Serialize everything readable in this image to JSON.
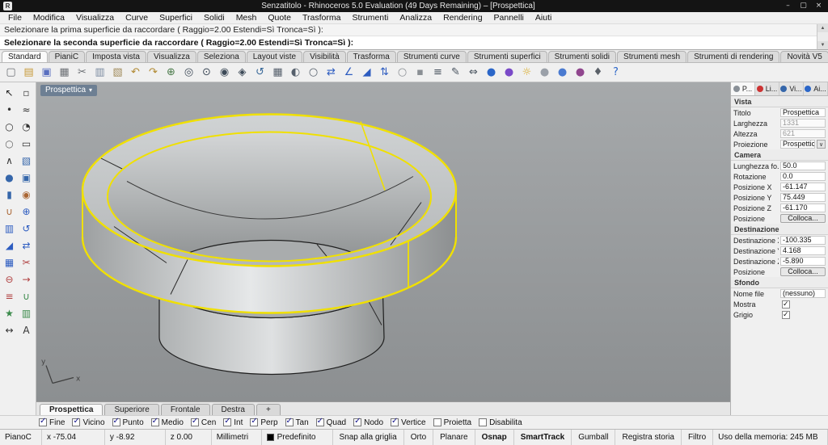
{
  "title_bar": {
    "title": "Senzatitolo - Rhinoceros 5.0 Evaluation (49 Days Remaining) – [Prospettica]",
    "window_controls": [
      {
        "name": "minimize-button",
        "glyph": "–"
      },
      {
        "name": "maximize-button",
        "glyph": "▢"
      },
      {
        "name": "close-button",
        "glyph": "×"
      }
    ]
  },
  "menu_bar": {
    "items": [
      "File",
      "Modifica",
      "Visualizza",
      "Curve",
      "Superfici",
      "Solidi",
      "Mesh",
      "Quote",
      "Trasforma",
      "Strumenti",
      "Analizza",
      "Rendering",
      "Pannelli",
      "Aiuti"
    ]
  },
  "command": {
    "line1": "Selezionare la prima superficie da raccordare ( Raggio=2.00  Estendi=Sì  Tronca=Sì ):",
    "line2": "Selezionare la seconda superficie da raccordare ( Raggio=2.00  Estendi=Sì  Tronca=Sì ):"
  },
  "ribbon": {
    "tabs": [
      {
        "label": "Standard",
        "active": true
      },
      {
        "label": "PianiC"
      },
      {
        "label": "Imposta vista"
      },
      {
        "label": "Visualizza"
      },
      {
        "label": "Seleziona"
      },
      {
        "label": "Layout viste"
      },
      {
        "label": "Visibilità"
      },
      {
        "label": "Trasforma"
      },
      {
        "label": "Strumenti curve"
      },
      {
        "label": "Strumenti superfici"
      },
      {
        "label": "Strumenti solidi"
      },
      {
        "label": "Strumenti mesh"
      },
      {
        "label": "Strumenti di rendering"
      },
      {
        "label": "Novità V5"
      }
    ]
  },
  "toolbar": {
    "icons": [
      {
        "name": "new-file-icon",
        "glyph": "▢",
        "color": "#6b6f74"
      },
      {
        "name": "open-file-icon",
        "glyph": "▤",
        "color": "#c79a3a"
      },
      {
        "name": "save-icon",
        "glyph": "▣",
        "color": "#5a6fc0"
      },
      {
        "name": "print-icon",
        "glyph": "▦",
        "color": "#6b6f74"
      },
      {
        "name": "cut-icon",
        "glyph": "✂",
        "color": "#6b6f74"
      },
      {
        "name": "copy-icon",
        "glyph": "▥",
        "color": "#7a8aa0"
      },
      {
        "name": "paste-icon",
        "glyph": "▧",
        "color": "#a08a5a"
      },
      {
        "name": "undo-icon",
        "glyph": "↶",
        "color": "#b08830"
      },
      {
        "name": "redo-icon",
        "glyph": "↷",
        "color": "#b08830"
      },
      {
        "name": "pan-icon",
        "glyph": "⊕",
        "color": "#4a7a4a"
      },
      {
        "name": "zoom-dynamic-icon",
        "glyph": "◎",
        "color": "#3d4a58"
      },
      {
        "name": "zoom-window-icon",
        "glyph": "⊙",
        "color": "#3d4a58"
      },
      {
        "name": "zoom-extents-icon",
        "glyph": "◉",
        "color": "#3d4a58"
      },
      {
        "name": "zoom-selected-icon",
        "glyph": "◈",
        "color": "#3d4a58"
      },
      {
        "name": "undo-view-icon",
        "glyph": "↺",
        "color": "#3a6a9a"
      },
      {
        "name": "four-viewports-icon",
        "glyph": "▦",
        "color": "#56606c"
      },
      {
        "name": "shaded-view-icon",
        "glyph": "◐",
        "color": "#56606c"
      },
      {
        "name": "wireframe-view-icon",
        "glyph": "○",
        "color": "#56606c"
      },
      {
        "name": "move-icon",
        "glyph": "⇄",
        "color": "#2d5cc0"
      },
      {
        "name": "rotate-icon",
        "glyph": "∠",
        "color": "#2d5cc0"
      },
      {
        "name": "scale-icon",
        "glyph": "◢",
        "color": "#2d5cc0"
      },
      {
        "name": "mirror-icon",
        "glyph": "⇅",
        "color": "#2d5cc0"
      },
      {
        "name": "hide-objects-icon",
        "glyph": "○",
        "color": "#8a8f94"
      },
      {
        "name": "lock-objects-icon",
        "glyph": "▪",
        "color": "#8a8f94"
      },
      {
        "name": "layers-icon",
        "glyph": "≡",
        "color": "#45505c"
      },
      {
        "name": "object-properties-icon",
        "glyph": "✎",
        "color": "#45505c"
      },
      {
        "name": "distance-icon",
        "glyph": "⇔",
        "color": "#45505c"
      },
      {
        "name": "render-icon",
        "glyph": "●",
        "color": "#2b66c8"
      },
      {
        "name": "render-preview-icon",
        "glyph": "●",
        "color": "#7a4ac8"
      },
      {
        "name": "spotlight-icon",
        "glyph": "☼",
        "color": "#d8a820"
      },
      {
        "name": "display-wireframe-icon",
        "glyph": "●",
        "color": "#9aa0a8"
      },
      {
        "name": "display-shaded-icon",
        "glyph": "●",
        "color": "#4a7ad0"
      },
      {
        "name": "display-rendered-icon",
        "glyph": "●",
        "color": "#90468e"
      },
      {
        "name": "notes-icon",
        "glyph": "♦",
        "color": "#5a6068"
      },
      {
        "name": "help-icon",
        "glyph": "?",
        "color": "#2b66c8"
      }
    ]
  },
  "side_toolbar": {
    "icons": [
      {
        "name": "select-arrow-icon",
        "glyph": "↖",
        "color": "#1a1a1a"
      },
      {
        "name": "selection-filter-icon",
        "glyph": "▫",
        "color": "#444444"
      },
      {
        "name": "point-icon",
        "glyph": "•",
        "color": "#333333"
      },
      {
        "name": "curve-icon",
        "glyph": "≈",
        "color": "#333333"
      },
      {
        "name": "circle-icon",
        "glyph": "○",
        "color": "#333333"
      },
      {
        "name": "arc-icon",
        "glyph": "◔",
        "color": "#333333"
      },
      {
        "name": "ellipse-icon",
        "glyph": "○",
        "color": "#666666"
      },
      {
        "name": "rectangle-icon",
        "glyph": "▭",
        "color": "#333333"
      },
      {
        "name": "polyline-icon",
        "glyph": "∧",
        "color": "#333333"
      },
      {
        "name": "surface-icon",
        "glyph": "▧",
        "color": "#3566aa"
      },
      {
        "name": "sphere-icon",
        "glyph": "●",
        "color": "#3566aa"
      },
      {
        "name": "box-icon",
        "glyph": "▣",
        "color": "#3566aa"
      },
      {
        "name": "cylinder-icon",
        "glyph": "▮",
        "color": "#3566aa"
      },
      {
        "name": "fillet-icon",
        "glyph": "◉",
        "color": "#aa6633"
      },
      {
        "name": "boolean-union-icon",
        "glyph": "∪",
        "color": "#aa6633"
      },
      {
        "name": "move-tool-icon",
        "glyph": "⊕",
        "color": "#2d5cc0"
      },
      {
        "name": "copy-tool-icon",
        "glyph": "▥",
        "color": "#2d5cc0"
      },
      {
        "name": "rotate-tool-icon",
        "glyph": "↺",
        "color": "#2d5cc0"
      },
      {
        "name": "scale-tool-icon",
        "glyph": "◢",
        "color": "#2d5cc0"
      },
      {
        "name": "mirror-tool-icon",
        "glyph": "⇄",
        "color": "#2d5cc0"
      },
      {
        "name": "array-icon",
        "glyph": "▦",
        "color": "#2d5cc0"
      },
      {
        "name": "trim-icon",
        "glyph": "✂",
        "color": "#b04040"
      },
      {
        "name": "split-icon",
        "glyph": "⊖",
        "color": "#b04040"
      },
      {
        "name": "extend-icon",
        "glyph": "→",
        "color": "#b04040"
      },
      {
        "name": "offset-icon",
        "glyph": "≡",
        "color": "#b04040"
      },
      {
        "name": "join-icon",
        "glyph": "∪",
        "color": "#3a8a4a"
      },
      {
        "name": "explode-icon",
        "glyph": "★",
        "color": "#3a8a4a"
      },
      {
        "name": "group-icon",
        "glyph": "▥",
        "color": "#3a8a4a"
      },
      {
        "name": "dimension-icon",
        "glyph": "↔",
        "color": "#333333"
      },
      {
        "name": "text-icon",
        "glyph": "A",
        "color": "#333333"
      }
    ]
  },
  "viewport": {
    "title": "Prospettica",
    "axis_x_label": "x",
    "axis_y_label": "y",
    "selection_color": "#f0e000",
    "tabs": [
      {
        "label": "Prospettica",
        "active": true
      },
      {
        "label": "Superiore"
      },
      {
        "label": "Frontale"
      },
      {
        "label": "Destra"
      },
      {
        "label": "+",
        "name": "new-viewport-tab"
      }
    ]
  },
  "right_panel": {
    "tabs": [
      {
        "name": "tab-proprieta",
        "label": "P...",
        "active": true,
        "color": "#8a9097"
      },
      {
        "name": "tab-livelli",
        "label": "Li...",
        "color": "#cc3333"
      },
      {
        "name": "tab-visualizza",
        "label": "Vi...",
        "color": "#3566aa"
      },
      {
        "name": "tab-aiuto",
        "label": "Ai...",
        "color": "#2b66c8"
      }
    ],
    "vista": {
      "header": "Vista",
      "rows": [
        {
          "label": "Titolo",
          "value": "Prospettica"
        },
        {
          "label": "Larghezza",
          "value": "1331",
          "readonly": true
        },
        {
          "label": "Altezza",
          "value": "621",
          "readonly": true
        },
        {
          "label": "Proiezione",
          "value": "Prospettica",
          "dropdown": true
        }
      ]
    },
    "camera": {
      "header": "Camera",
      "rows": [
        {
          "label": "Lunghezza fo...",
          "value": "50.0"
        },
        {
          "label": "Rotazione",
          "value": "0.0"
        },
        {
          "label": "Posizione X",
          "value": "-61.147"
        },
        {
          "label": "Posizione Y",
          "value": "75.449"
        },
        {
          "label": "Posizione Z",
          "value": "-61.170"
        },
        {
          "label": "Posizione",
          "value": "Colloca...",
          "button": true
        }
      ]
    },
    "destinazione": {
      "header": "Destinazione",
      "rows": [
        {
          "label": "Destinazione X",
          "value": "-100.335"
        },
        {
          "label": "Destinazione Y",
          "value": "4.168"
        },
        {
          "label": "Destinazione Z",
          "value": "-5.890"
        },
        {
          "label": "Posizione",
          "value": "Colloca...",
          "button": true
        }
      ]
    },
    "sfondo": {
      "header": "Sfondo",
      "rows": [
        {
          "label": "Nome file",
          "value": "(nessuno)"
        },
        {
          "label": "Mostra",
          "checkbox": true,
          "checked": true
        },
        {
          "label": "Grigio",
          "checkbox": true,
          "checked": true
        }
      ]
    }
  },
  "osnap": {
    "items": [
      {
        "label": "Fine",
        "checked": true
      },
      {
        "label": "Vicino",
        "checked": true
      },
      {
        "label": "Punto",
        "checked": true
      },
      {
        "label": "Medio",
        "checked": true
      },
      {
        "label": "Cen",
        "checked": true
      },
      {
        "label": "Int",
        "checked": true
      },
      {
        "label": "Perp",
        "checked": true
      },
      {
        "label": "Tan",
        "checked": true
      },
      {
        "label": "Quad",
        "checked": true
      },
      {
        "label": "Nodo",
        "checked": true
      },
      {
        "label": "Vertice",
        "checked": true
      },
      {
        "label": "Proietta"
      },
      {
        "label": "Disabilita"
      }
    ]
  },
  "status_bar": {
    "cplane": "PianoC",
    "x": "x -75.04",
    "y": "y -8.92",
    "z": "z 0.00",
    "units": "Millimetri",
    "layer": "Predefinito",
    "layer_color": "#000000",
    "toggles": [
      {
        "label": "Snap alla griglia"
      },
      {
        "label": "Orto"
      },
      {
        "label": "Planare"
      },
      {
        "label": "Osnap",
        "bold": true
      },
      {
        "label": "SmartTrack",
        "bold": true
      },
      {
        "label": "Gumball"
      },
      {
        "label": "Registra storia"
      },
      {
        "label": "Filtro"
      }
    ],
    "memory": "Uso della memoria: 245 MB"
  }
}
